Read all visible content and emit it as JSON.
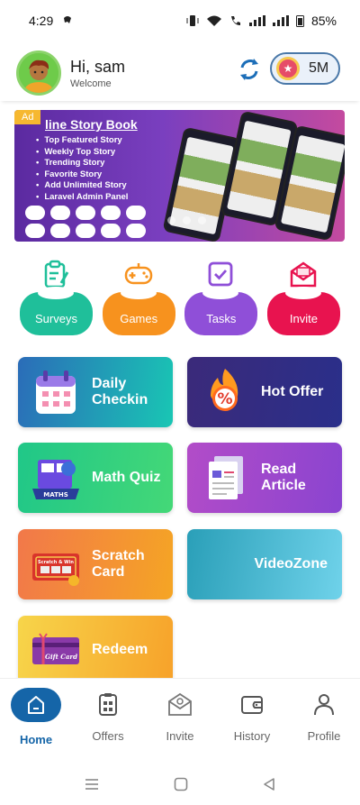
{
  "status_bar": {
    "time": "4:29",
    "battery": "85%"
  },
  "header": {
    "greeting": "Hi, sam",
    "subtitle": "Welcome",
    "coins": "5M"
  },
  "ad": {
    "badge": "Ad",
    "title": "line Story Book",
    "items": [
      "Top Featured Story",
      "Weekly Top Story",
      "Trending Story",
      "Favorite Story",
      "Add Unlimited Story",
      "Laravel Admin Panel"
    ]
  },
  "categories": [
    {
      "label": "Surveys",
      "color": "#1fbf9a",
      "icon": "clipboard-icon"
    },
    {
      "label": "Games",
      "color": "#f7921e",
      "icon": "gamepad-icon"
    },
    {
      "label": "Tasks",
      "color": "#8f4fd8",
      "icon": "checkbox-icon"
    },
    {
      "label": "Invite",
      "color": "#e8134f",
      "icon": "envelope-icon"
    }
  ],
  "cards": [
    {
      "label": "Daily\nCheckin",
      "icon": "calendar-icon"
    },
    {
      "label": "Hot Offer",
      "icon": "percent-flame-icon"
    },
    {
      "label": "Math Quiz",
      "icon": "math-book-icon"
    },
    {
      "label": "Read\nArticle",
      "icon": "article-icon"
    },
    {
      "label": "Scratch\nCard",
      "icon": "scratch-card-icon"
    },
    {
      "label": "VideoZone",
      "icon": ""
    },
    {
      "label": "Redeem",
      "icon": "gift-card-icon"
    }
  ],
  "card_icon_texts": {
    "maths": "MATHS",
    "scratch": "Scratch & Win",
    "gift": "Gift Card"
  },
  "nav": [
    {
      "label": "Home",
      "icon": "home-icon",
      "active": true
    },
    {
      "label": "Offers",
      "icon": "offers-icon",
      "active": false
    },
    {
      "label": "Invite",
      "icon": "invite-icon",
      "active": false
    },
    {
      "label": "History",
      "icon": "wallet-icon",
      "active": false
    },
    {
      "label": "Profile",
      "icon": "person-icon",
      "active": false
    }
  ]
}
